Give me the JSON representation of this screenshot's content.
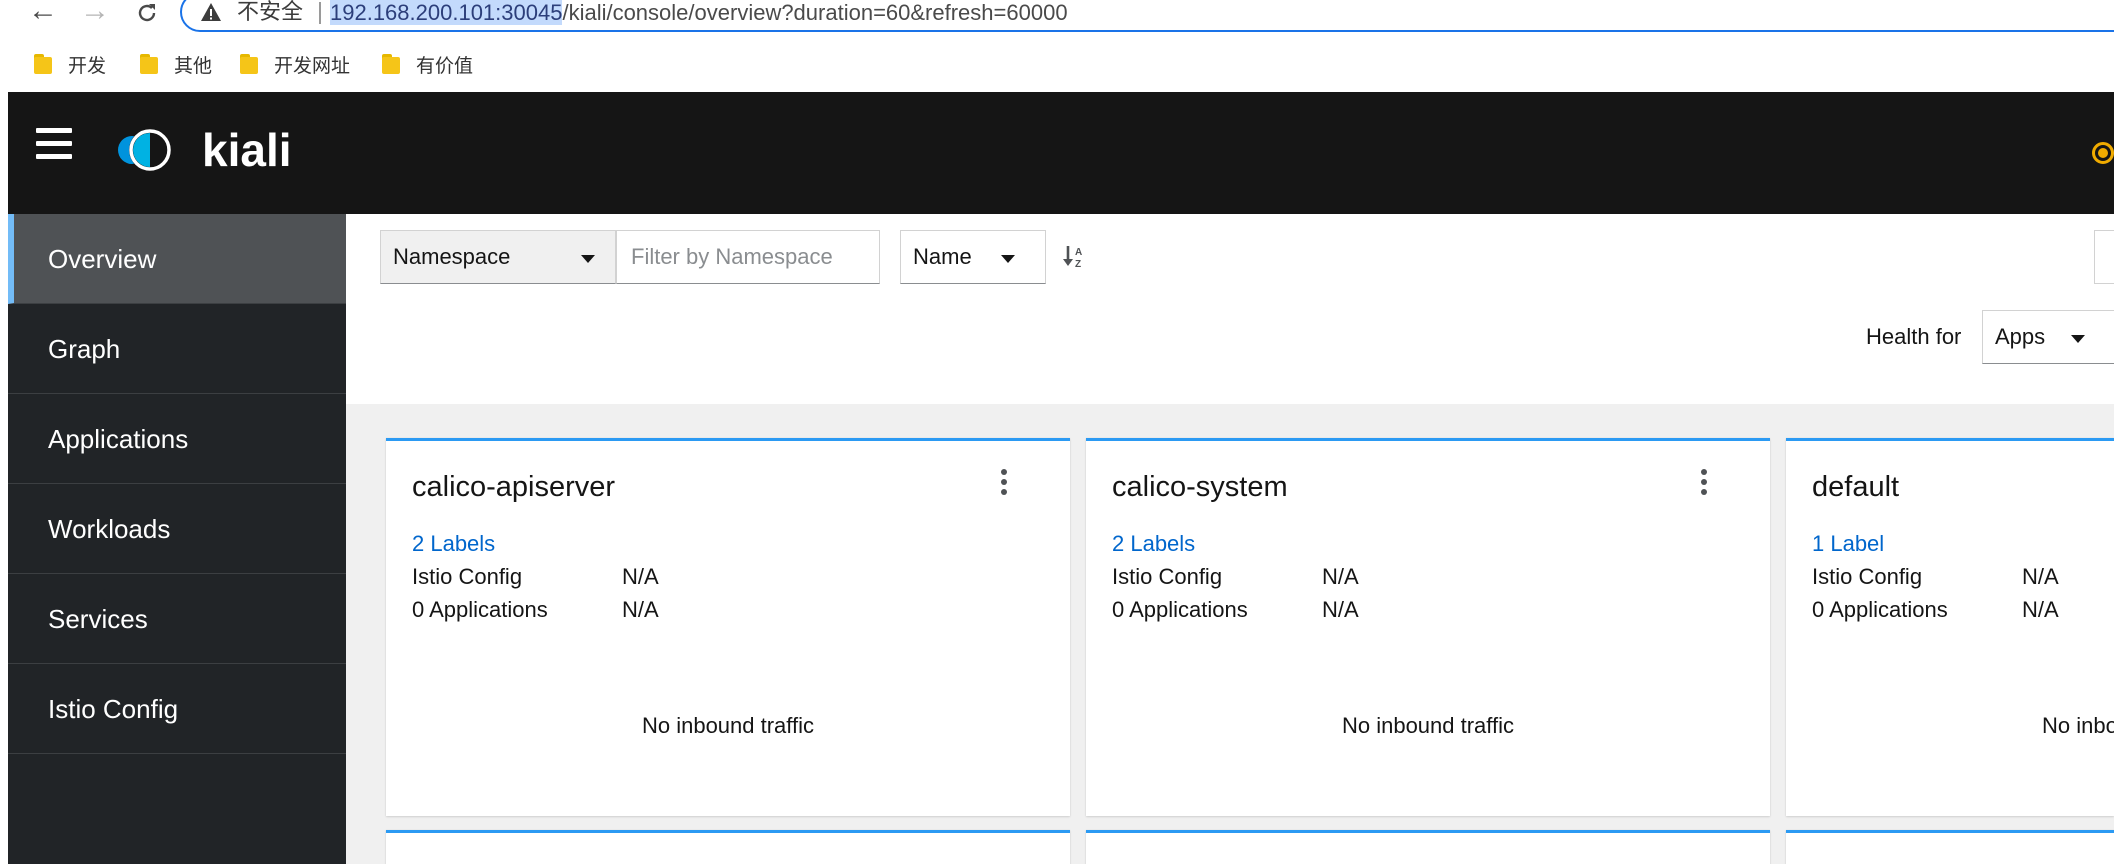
{
  "browser": {
    "insecure_label": "不安全",
    "url_host": "192.168.200.101:30045",
    "url_path": "/kiali/console/overview?duration=60&refresh=60000",
    "bookmarks": [
      "开发",
      "其他",
      "开发网址",
      "有价值"
    ]
  },
  "masthead": {
    "logo_text": "kiali",
    "status_color": "#f0ab00"
  },
  "sidebar": {
    "items": [
      {
        "label": "Overview",
        "active": true
      },
      {
        "label": "Graph",
        "active": false
      },
      {
        "label": "Applications",
        "active": false
      },
      {
        "label": "Workloads",
        "active": false
      },
      {
        "label": "Services",
        "active": false
      },
      {
        "label": "Istio Config",
        "active": false
      }
    ]
  },
  "toolbar": {
    "filter_type": "Namespace",
    "filter_placeholder": "Filter by Namespace",
    "sort_field": "Name",
    "health_label": "Health for",
    "health_value": "Apps"
  },
  "cards": [
    {
      "title": "calico-apiserver",
      "labels": "2 Labels",
      "istio_config_label": "Istio Config",
      "istio_config_value": "N/A",
      "applications_label": "0 Applications",
      "applications_value": "N/A",
      "traffic": "No inbound traffic"
    },
    {
      "title": "calico-system",
      "labels": "2 Labels",
      "istio_config_label": "Istio Config",
      "istio_config_value": "N/A",
      "applications_label": "0 Applications",
      "applications_value": "N/A",
      "traffic": "No inbound traffic"
    },
    {
      "title": "default",
      "labels": "1 Label",
      "istio_config_label": "Istio Config",
      "istio_config_value": "N/A",
      "applications_label": "0 Applications",
      "applications_value": "N/A",
      "traffic": "No inbound traffic"
    }
  ],
  "colors": {
    "accent": "#2b9af3",
    "link": "#0066cc",
    "sidebar_bg": "#212427",
    "masthead_bg": "#151515"
  }
}
